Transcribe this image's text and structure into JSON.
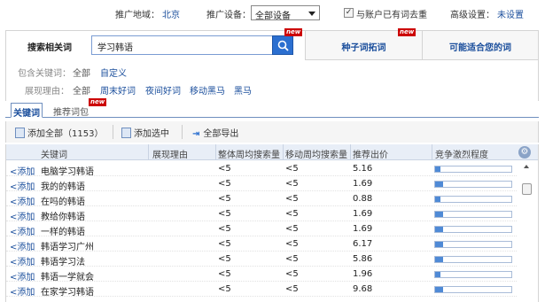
{
  "top": {
    "region_label": "推广地域：",
    "region_value": "北京",
    "device_label": "推广设备：",
    "device_value": "全部设备",
    "dedupe_label": "与账户已有词去重",
    "dedupe_checked": true,
    "advanced_label": "高级设置：",
    "advanced_value": "未设置"
  },
  "tabs": {
    "search_label": "搜索相关词",
    "search_value": "学习韩语",
    "seed_label": "种子词拓词",
    "suitable_label": "可能适合您的词",
    "new_badge": "new"
  },
  "filters": {
    "include_label": "包含关键词：",
    "include_options": [
      "全部",
      "自定义"
    ],
    "reason_label": "展现理由：",
    "reason_options": [
      "全部",
      "周末好词",
      "夜间好词",
      "移动黑马",
      "黑马"
    ]
  },
  "subtabs": {
    "active": "关键词",
    "other": "推荐词包",
    "new_badge": "new"
  },
  "toolbar": {
    "add_all": "添加全部（1153）",
    "add_selected": "添加选中",
    "export_all": "全部导出"
  },
  "table": {
    "headers": [
      "关键词",
      "展现理由",
      "整体周均搜索量",
      "移动周均搜索量",
      "推荐出价",
      "竞争激烈程度"
    ],
    "add_label": "<添加",
    "rows": [
      {
        "keyword": "电脑学习韩语",
        "reason": "",
        "total": "<5",
        "mobile": "<5",
        "bid": "5.16",
        "competition": 0.07
      },
      {
        "keyword": "我的的韩语",
        "reason": "",
        "total": "<5",
        "mobile": "<5",
        "bid": "1.69",
        "competition": 0.1
      },
      {
        "keyword": "在吗的韩语",
        "reason": "",
        "total": "<5",
        "mobile": "<5",
        "bid": "0.88",
        "competition": 0.07
      },
      {
        "keyword": "教给你韩语",
        "reason": "",
        "total": "<5",
        "mobile": "<5",
        "bid": "1.69",
        "competition": 0.1
      },
      {
        "keyword": "一样的韩语",
        "reason": "",
        "total": "<5",
        "mobile": "<5",
        "bid": "1.69",
        "competition": 0.1
      },
      {
        "keyword": "韩语学习广州",
        "reason": "",
        "total": "<5",
        "mobile": "<5",
        "bid": "6.17",
        "competition": 0.1
      },
      {
        "keyword": "韩语学习法",
        "reason": "",
        "total": "<5",
        "mobile": "<5",
        "bid": "5.86",
        "competition": 0.1
      },
      {
        "keyword": "韩语一学就会",
        "reason": "",
        "total": "<5",
        "mobile": "<5",
        "bid": "1.96",
        "competition": 0.07
      },
      {
        "keyword": "在家学习韩语",
        "reason": "",
        "total": "<5",
        "mobile": "<5",
        "bid": "9.68",
        "competition": 0.1
      }
    ]
  },
  "colors": {
    "accent": "#1a4e9c",
    "search_button": "#2b6fd0",
    "bar_fill": "#4f8ad6",
    "badge": "#cc0000"
  }
}
